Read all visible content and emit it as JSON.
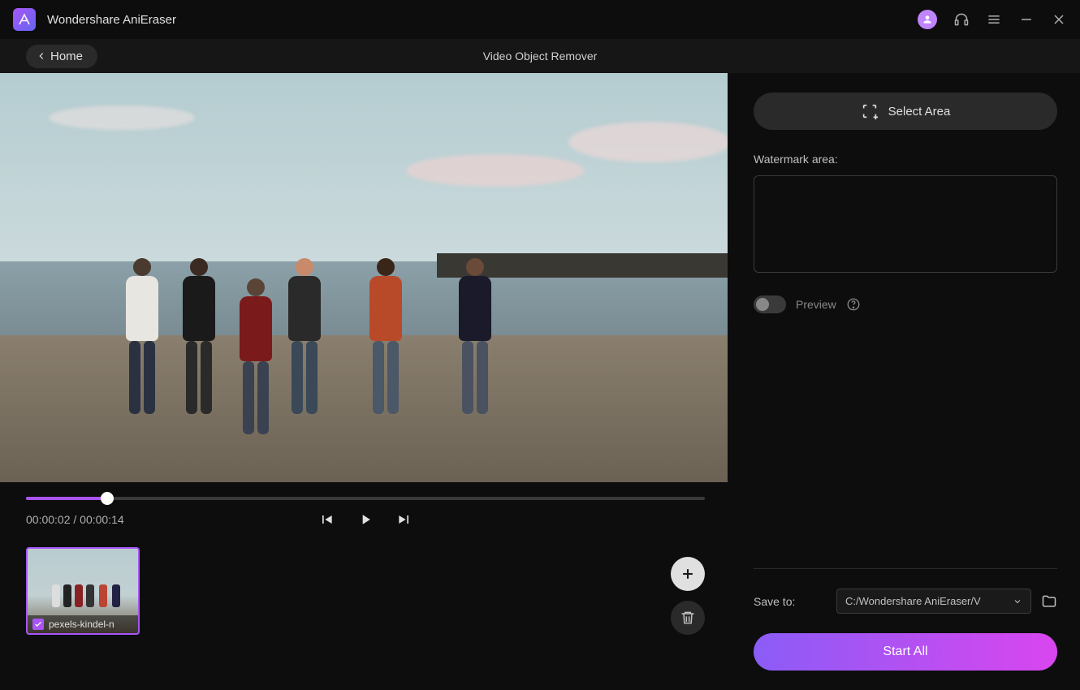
{
  "app": {
    "title": "Wondershare AniEraser"
  },
  "subheader": {
    "home_label": "Home",
    "page_title": "Video Object Remover"
  },
  "player": {
    "current_time": "00:00:02",
    "duration": "00:00:14"
  },
  "thumbnail": {
    "filename": "pexels-kindel-n"
  },
  "sidebar": {
    "select_area_label": "Select Area",
    "watermark_label": "Watermark area:",
    "preview_label": "Preview",
    "save_label": "Save to:",
    "save_path": "C:/Wondershare AniEraser/V",
    "start_label": "Start All"
  }
}
